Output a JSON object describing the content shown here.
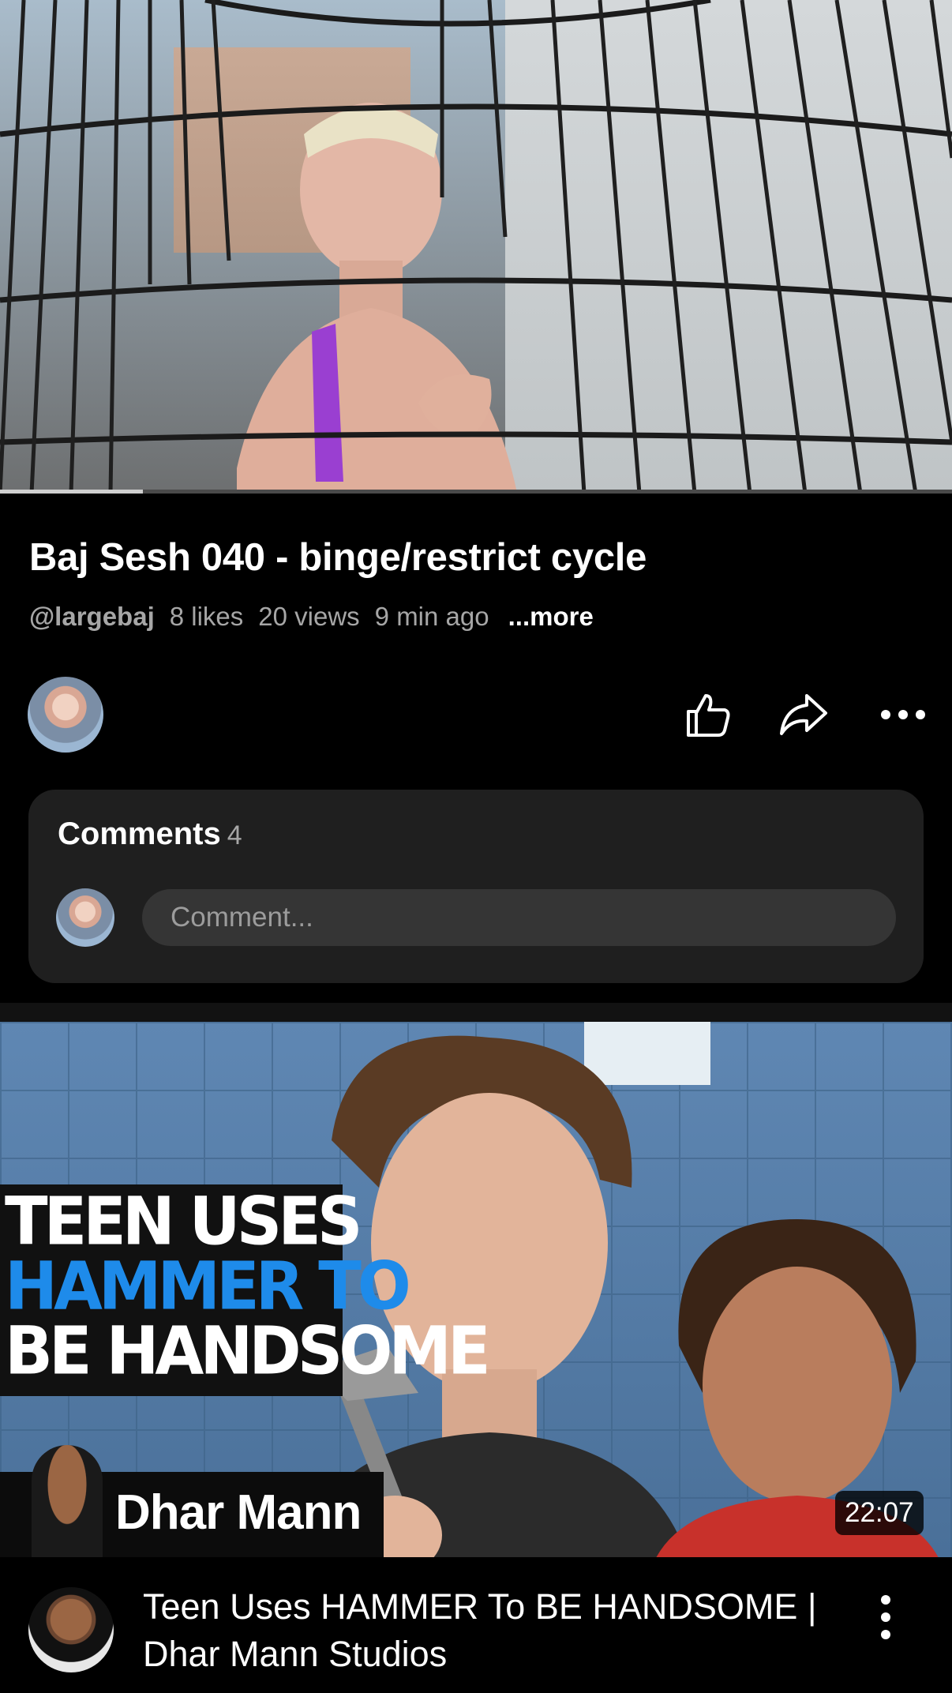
{
  "player": {
    "progress_fraction": 0.15
  },
  "video": {
    "title": "Baj Sesh 040 - binge/restrict cycle",
    "channel_handle": "@largebaj",
    "likes": "8 likes",
    "views": "20 views",
    "age": "9 min ago",
    "more_label": "...more"
  },
  "actions": {
    "like_icon": "thumbs-up-icon",
    "share_icon": "share-arrow-icon",
    "more_icon": "horizontal-ellipsis-icon"
  },
  "comments": {
    "heading": "Comments",
    "count": "4",
    "input_placeholder": "Comment..."
  },
  "recommended": {
    "thumbnail_headline": [
      "TEEN USES",
      "HAMMER TO",
      "BE HANDSOME"
    ],
    "thumbnail_brand": "Dhar Mann",
    "duration": "22:07",
    "title": "Teen Uses HAMMER To BE HANDSOME | Dhar Mann Studios",
    "menu_icon": "vertical-ellipsis-icon"
  },
  "colors": {
    "background": "#000000",
    "card": "#1f1f1f",
    "accent_blue": "#1e8bea",
    "muted_text": "#a6a6a6"
  }
}
